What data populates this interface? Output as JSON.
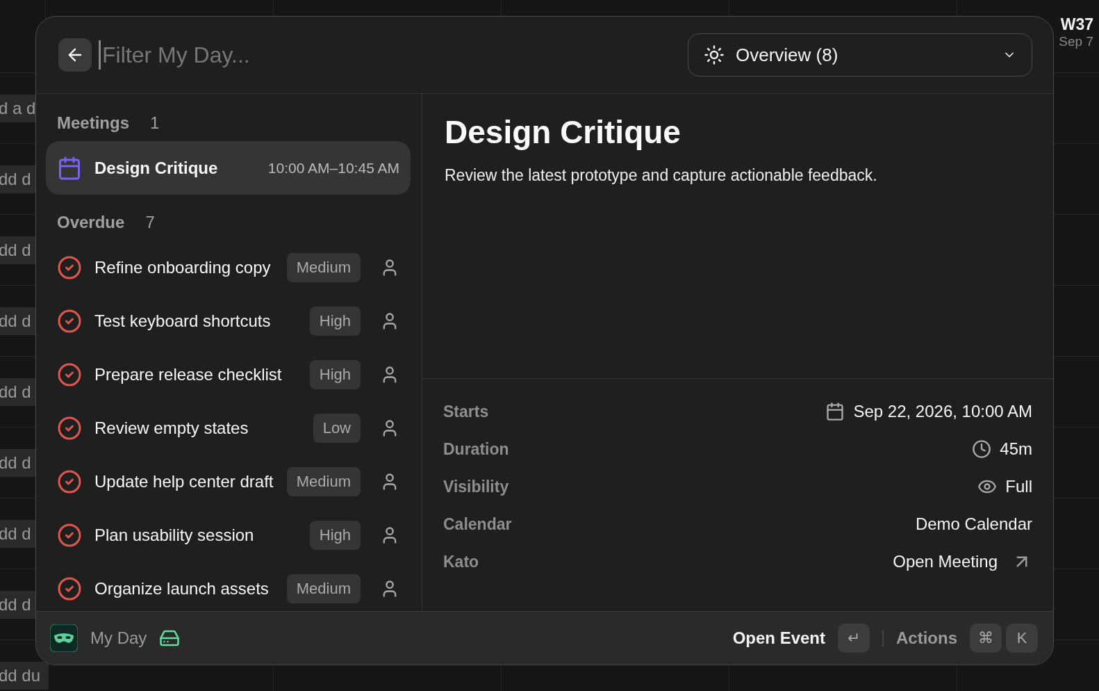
{
  "background": {
    "week": "W37",
    "date": "Sep 7",
    "event_fragments": [
      "d a d",
      "dd d",
      "dd d",
      "dd d",
      "dd d",
      "dd d",
      "dd d",
      "dd d",
      "dd du"
    ]
  },
  "search": {
    "placeholder": "Filter My Day..."
  },
  "view_select": {
    "label": "Overview (8)"
  },
  "sections": [
    {
      "title": "Meetings",
      "count": "1",
      "items": [
        {
          "kind": "meeting",
          "title": "Design Critique",
          "time": "10:00 AM–10:45 AM",
          "selected": true
        }
      ]
    },
    {
      "title": "Overdue",
      "count": "7",
      "items": [
        {
          "kind": "task",
          "title": "Refine onboarding copy",
          "priority": "Medium",
          "selected": false
        },
        {
          "kind": "task",
          "title": "Test keyboard shortcuts",
          "priority": "High",
          "selected": false
        },
        {
          "kind": "task",
          "title": "Prepare release checklist",
          "priority": "High",
          "selected": false
        },
        {
          "kind": "task",
          "title": "Review empty states",
          "priority": "Low",
          "selected": false
        },
        {
          "kind": "task",
          "title": "Update help center draft",
          "priority": "Medium",
          "selected": false
        },
        {
          "kind": "task",
          "title": "Plan usability session",
          "priority": "High",
          "selected": false
        },
        {
          "kind": "task",
          "title": "Organize launch assets",
          "priority": "Medium",
          "selected": false
        }
      ]
    }
  ],
  "detail": {
    "title": "Design Critique",
    "description": "Review the latest prototype and capture actionable feedback.",
    "properties": [
      {
        "label": "Starts",
        "value": "Sep 22, 2026, 10:00 AM",
        "kind": "date"
      },
      {
        "label": "Duration",
        "value": "45m",
        "kind": "duration"
      },
      {
        "label": "Visibility",
        "value": "Full",
        "kind": "visibility"
      },
      {
        "label": "Calendar",
        "value": "Demo Calendar",
        "kind": "text"
      },
      {
        "label": "Kato",
        "value": "Open Meeting",
        "kind": "link"
      }
    ]
  },
  "footer": {
    "title": "My Day",
    "primary_action": "Open Event",
    "primary_key": "↵",
    "secondary_action": "Actions",
    "secondary_keys": [
      "⌘",
      "K"
    ]
  }
}
